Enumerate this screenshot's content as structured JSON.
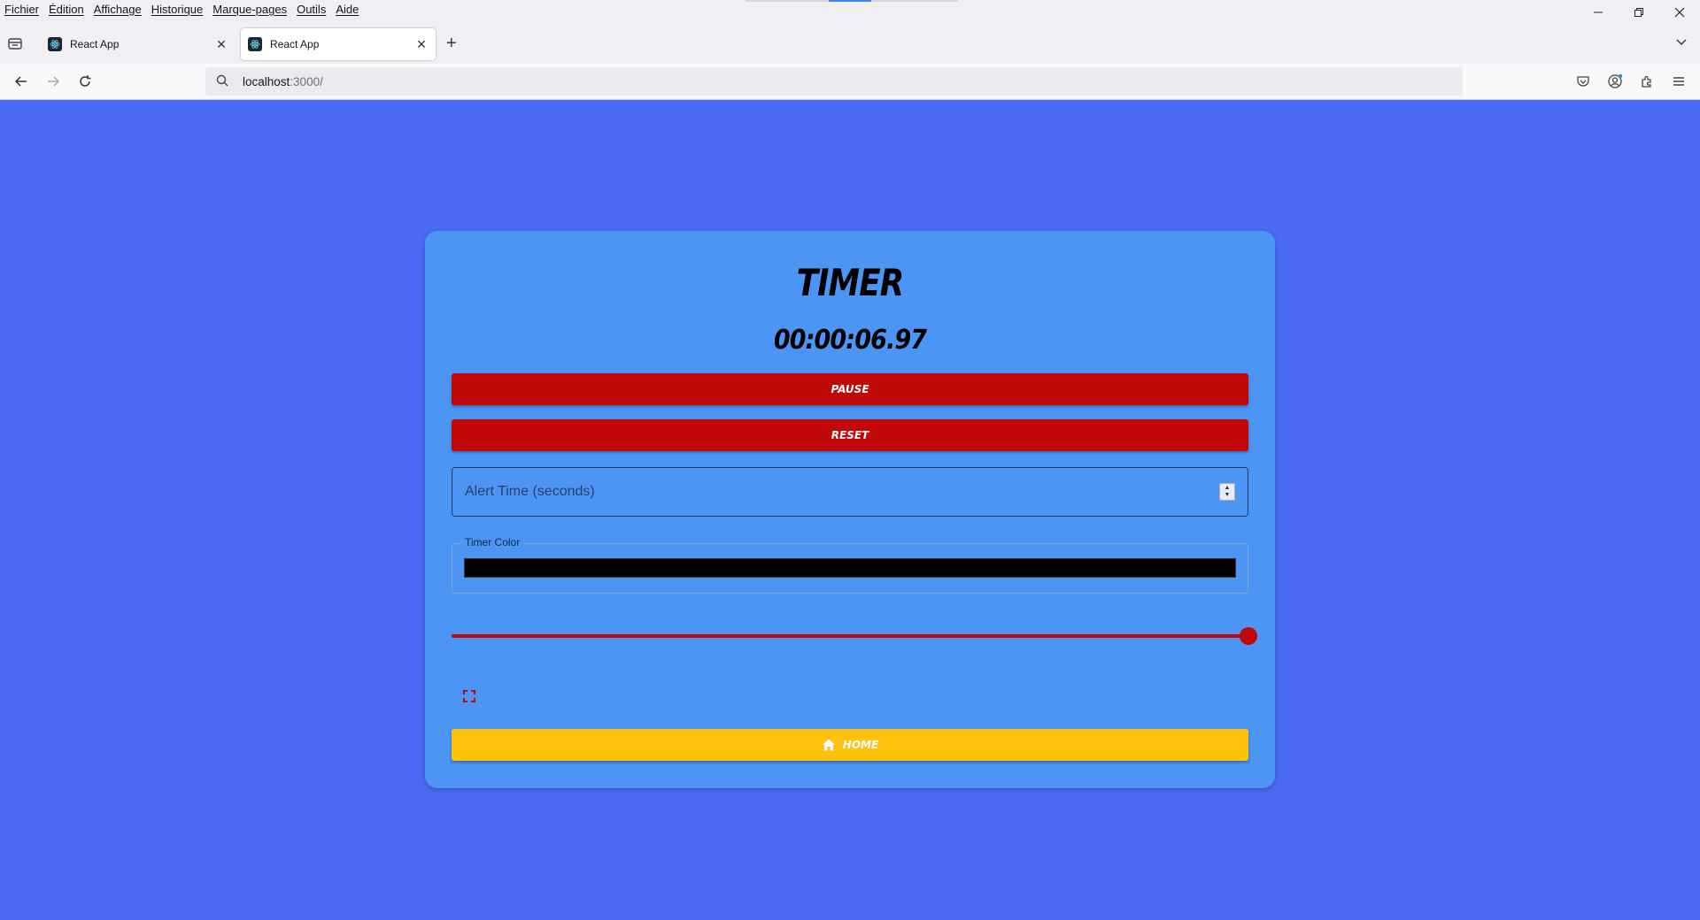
{
  "browser": {
    "menu": [
      "Fichier",
      "Édition",
      "Affichage",
      "Historique",
      "Marque-pages",
      "Outils",
      "Aide"
    ],
    "tabs": [
      {
        "title": "React App",
        "active": false
      },
      {
        "title": "React App",
        "active": true
      }
    ],
    "url": {
      "host": "localhost",
      "rest": ":3000/"
    }
  },
  "app": {
    "title": "TIMER",
    "time": "00:00:06.97",
    "pause_label": "PAUSE",
    "reset_label": "RESET",
    "alert_placeholder": "Alert Time (seconds)",
    "alert_value": "",
    "color_label": "Timer Color",
    "timer_color": "#000000",
    "slider_value": 1.0,
    "home_label": "HOME"
  },
  "colors": {
    "page_bg": "#4B6BF5",
    "card_bg": "#4C95F5",
    "button_red": "#C00808",
    "button_yellow": "#FCC20E"
  },
  "icons": {
    "fullscreen": "fullscreen-icon",
    "home": "home-icon"
  }
}
